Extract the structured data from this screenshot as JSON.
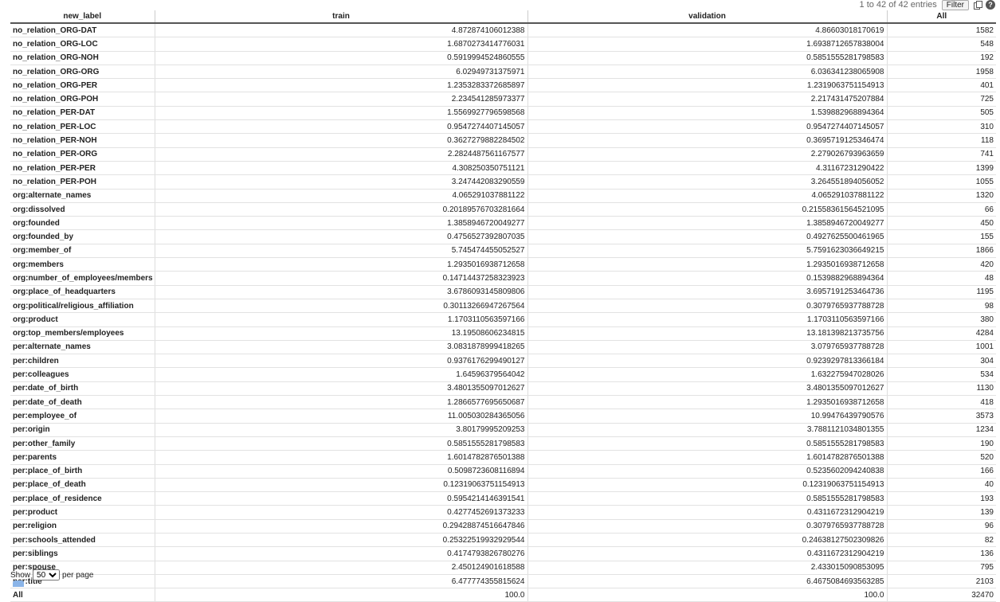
{
  "pager": {
    "entries_text": "1 to 42 of 42 entries",
    "filter_label": "Filter",
    "copy_icon": "copy-icon",
    "help_icon": "help-icon",
    "help_glyph": "?"
  },
  "table": {
    "columns": [
      "new_label",
      "train",
      "validation",
      "All"
    ],
    "rows": [
      [
        "no_relation_ORG-DAT",
        "4.872874106012388",
        "4.86603018170619",
        "1582"
      ],
      [
        "no_relation_ORG-LOC",
        "1.6870273414776031",
        "1.6938712657838004",
        "548"
      ],
      [
        "no_relation_ORG-NOH",
        "0.5919994524860555",
        "0.5851555281798583",
        "192"
      ],
      [
        "no_relation_ORG-ORG",
        "6.02949731375971",
        "6.036341238065908",
        "1958"
      ],
      [
        "no_relation_ORG-PER",
        "1.2353283372685897",
        "1.2319063751154913",
        "401"
      ],
      [
        "no_relation_ORG-POH",
        "2.234541285973377",
        "2.217431475207884",
        "725"
      ],
      [
        "no_relation_PER-DAT",
        "1.5569927796598568",
        "1.539882968894364",
        "505"
      ],
      [
        "no_relation_PER-LOC",
        "0.9547274407145057",
        "0.9547274407145057",
        "310"
      ],
      [
        "no_relation_PER-NOH",
        "0.3627279882284502",
        "0.3695719125346474",
        "118"
      ],
      [
        "no_relation_PER-ORG",
        "2.2824487561167577",
        "2.279026793963659",
        "741"
      ],
      [
        "no_relation_PER-PER",
        "4.308250350751121",
        "4.31167231290422",
        "1399"
      ],
      [
        "no_relation_PER-POH",
        "3.247442083290559",
        "3.264551894056052",
        "1055"
      ],
      [
        "org:alternate_names",
        "4.065291037881122",
        "4.065291037881122",
        "1320"
      ],
      [
        "org:dissolved",
        "0.20189576703281664",
        "0.21558361564521095",
        "66"
      ],
      [
        "org:founded",
        "1.3858946720049277",
        "1.3858946720049277",
        "450"
      ],
      [
        "org:founded_by",
        "0.4756527392807035",
        "0.4927625500461965",
        "155"
      ],
      [
        "org:member_of",
        "5.745474455052527",
        "5.7591623036649215",
        "1866"
      ],
      [
        "org:members",
        "1.2935016938712658",
        "1.2935016938712658",
        "420"
      ],
      [
        "org:number_of_employees/members",
        "0.14714437258323923",
        "0.1539882968894364",
        "48"
      ],
      [
        "org:place_of_headquarters",
        "3.6786093145809806",
        "3.6957191253464736",
        "1195"
      ],
      [
        "org:political/religious_affiliation",
        "0.30113266947267564",
        "0.3079765937788728",
        "98"
      ],
      [
        "org:product",
        "1.1703110563597166",
        "1.1703110563597166",
        "380"
      ],
      [
        "org:top_members/employees",
        "13.19508606234815",
        "13.181398213735756",
        "4284"
      ],
      [
        "per:alternate_names",
        "3.0831878999418265",
        "3.079765937788728",
        "1001"
      ],
      [
        "per:children",
        "0.9376176299490127",
        "0.9239297813366184",
        "304"
      ],
      [
        "per:colleagues",
        "1.64596379564042",
        "1.632275947028026",
        "534"
      ],
      [
        "per:date_of_birth",
        "3.4801355097012627",
        "3.4801355097012627",
        "1130"
      ],
      [
        "per:date_of_death",
        "1.2866577695650687",
        "1.2935016938712658",
        "418"
      ],
      [
        "per:employee_of",
        "11.005030284365056",
        "10.99476439790576",
        "3573"
      ],
      [
        "per:origin",
        "3.80179995209253",
        "3.7881121034801355",
        "1234"
      ],
      [
        "per:other_family",
        "0.5851555281798583",
        "0.5851555281798583",
        "190"
      ],
      [
        "per:parents",
        "1.6014782876501388",
        "1.6014782876501388",
        "520"
      ],
      [
        "per:place_of_birth",
        "0.5098723608116894",
        "0.5235602094240838",
        "166"
      ],
      [
        "per:place_of_death",
        "0.12319063751154913",
        "0.12319063751154913",
        "40"
      ],
      [
        "per:place_of_residence",
        "0.5954214146391541",
        "0.5851555281798583",
        "193"
      ],
      [
        "per:product",
        "0.4277452691373233",
        "0.4311672312904219",
        "139"
      ],
      [
        "per:religion",
        "0.29428874516647846",
        "0.3079765937788728",
        "96"
      ],
      [
        "per:schools_attended",
        "0.25322519932929544",
        "0.24638127502309826",
        "82"
      ],
      [
        "per:siblings",
        "0.4174793826780276",
        "0.4311672312904219",
        "136"
      ],
      [
        "per:spouse",
        "2.450124901618588",
        "2.433015090853095",
        "795"
      ],
      [
        "per:title",
        "6.477774355815624",
        "6.4675084693563285",
        "2103"
      ]
    ],
    "total": [
      "All",
      "100.0",
      "100.0",
      "32470"
    ]
  },
  "footer": {
    "show_label": "Show",
    "page_size": "50",
    "per_page_label": "per page"
  }
}
